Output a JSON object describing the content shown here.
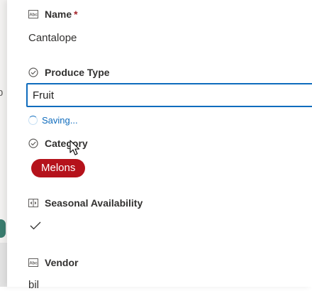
{
  "fields": {
    "name": {
      "label": "Name",
      "required_marker": "*",
      "value": "Cantalope",
      "icon": "text-field-icon"
    },
    "produce_type": {
      "label": "Produce Type",
      "value": "Fruit",
      "status": "Saving...",
      "icon": "choice-check-icon"
    },
    "category": {
      "label": "Category",
      "tag": "Melons",
      "tag_color": "#b5121b",
      "icon": "choice-check-icon"
    },
    "seasonal_availability": {
      "label": "Seasonal Availability",
      "value_icon": "checkmark-icon",
      "icon": "yes-no-toggle-icon"
    },
    "vendor": {
      "label": "Vendor",
      "value": "bil",
      "icon": "text-field-icon"
    }
  },
  "colors": {
    "accent": "#0f6cbd",
    "required": "#a4262c",
    "text": "#323130"
  }
}
